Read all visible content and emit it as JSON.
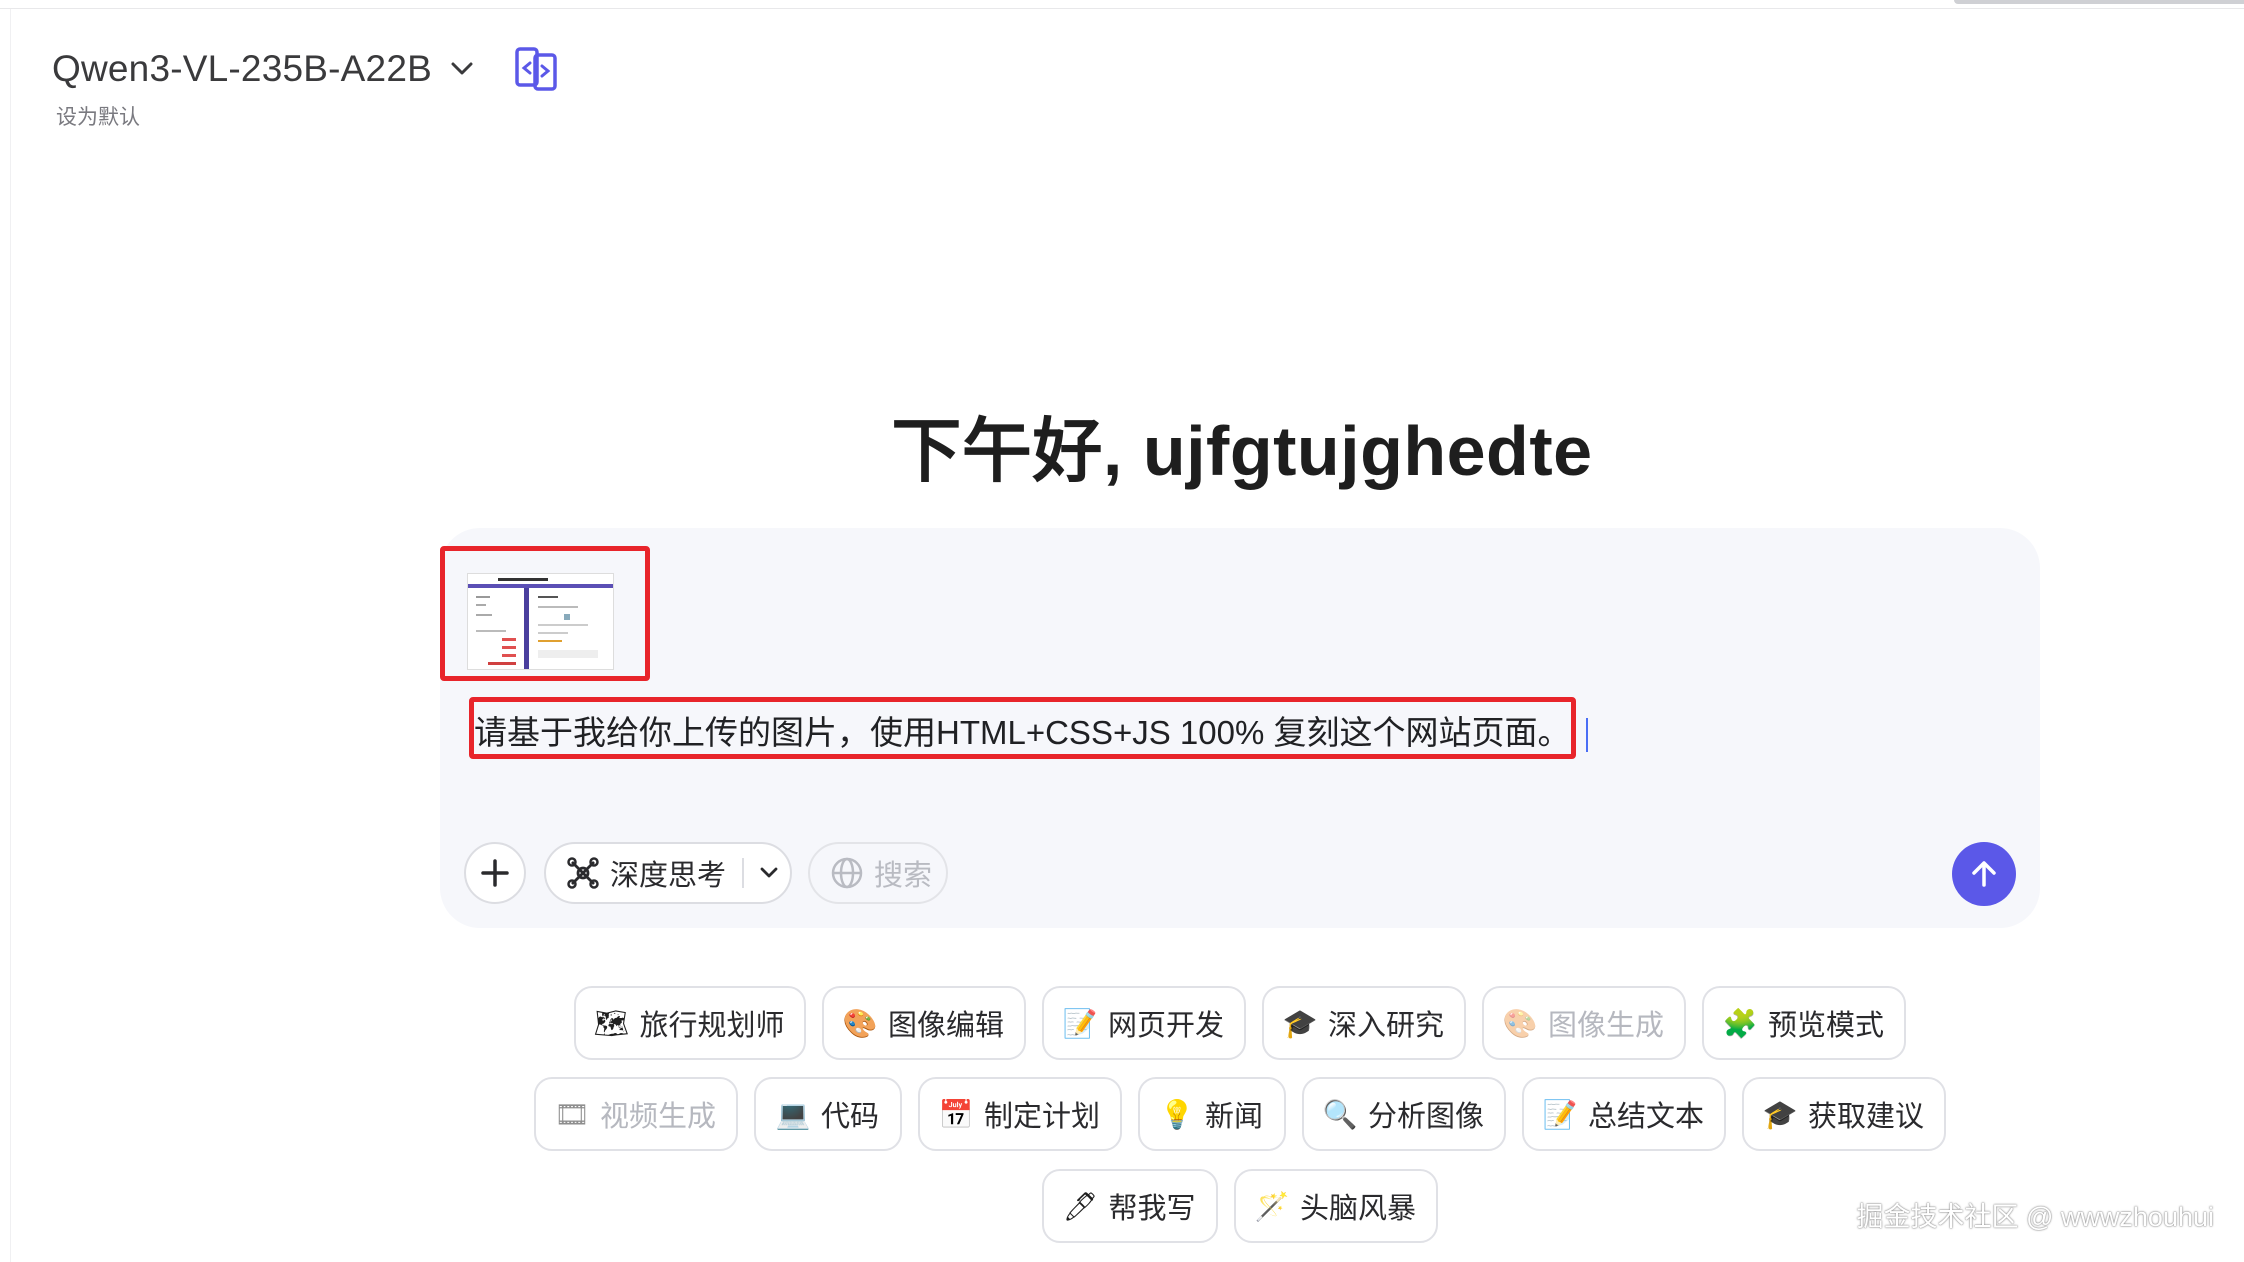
{
  "header": {
    "model_name": "Qwen3-VL-235B-A22B",
    "set_default": "设为默认"
  },
  "greeting": "下午好, ujfgtujghedte",
  "composer": {
    "prompt_text": "请基于我给你上传的图片，使用HTML+CSS+JS 100% 复刻这个网站页面。",
    "deep_think_label": "深度思考",
    "search_label": "搜索"
  },
  "suggestions": {
    "row1": [
      {
        "label": "旅行规划师",
        "icon": "map-icon",
        "enabled": true
      },
      {
        "label": "图像编辑",
        "icon": "palette-icon",
        "enabled": true
      },
      {
        "label": "网页开发",
        "icon": "memo-icon",
        "enabled": true
      },
      {
        "label": "深入研究",
        "icon": "graduation-cap-icon",
        "enabled": true
      },
      {
        "label": "图像生成",
        "icon": "palette-icon",
        "enabled": false
      },
      {
        "label": "预览模式",
        "icon": "puzzle-icon",
        "enabled": true
      }
    ],
    "row2": [
      {
        "label": "视频生成",
        "icon": "film-icon",
        "enabled": false
      },
      {
        "label": "代码",
        "icon": "laptop-icon",
        "enabled": true
      },
      {
        "label": "制定计划",
        "icon": "calendar-icon",
        "enabled": true
      },
      {
        "label": "新闻",
        "icon": "lightbulb-icon",
        "enabled": true
      },
      {
        "label": "分析图像",
        "icon": "magnifier-icon",
        "enabled": true
      },
      {
        "label": "总结文本",
        "icon": "memo-icon",
        "enabled": true
      },
      {
        "label": "获取建议",
        "icon": "graduation-cap-icon",
        "enabled": true
      }
    ],
    "row3": [
      {
        "label": "帮我写",
        "icon": "pen-icon",
        "enabled": true
      },
      {
        "label": "头脑风暴",
        "icon": "magic-wand-icon",
        "enabled": true
      }
    ]
  },
  "watermark": "掘金技术社区 @ wwwzhouhui"
}
